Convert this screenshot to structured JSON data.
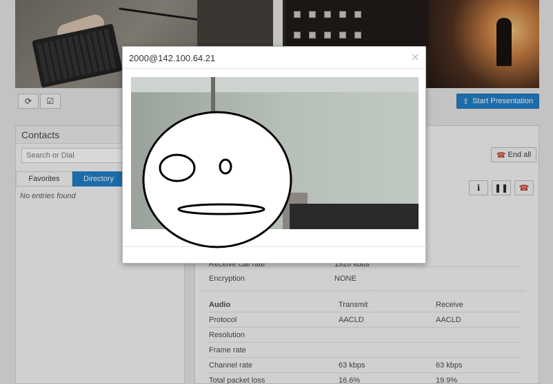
{
  "modal": {
    "title": "2000@142.100.64.21",
    "close_glyph": "×"
  },
  "toolbar": {
    "refresh_icon": "refresh-icon",
    "check_icon": "checkbox-icon",
    "present_label": "Start Presentation"
  },
  "contacts": {
    "title": "Contacts",
    "search_placeholder": "Search or Dial",
    "tabs": [
      "Favorites",
      "Directory"
    ],
    "empty_message": "No entries found"
  },
  "call": {
    "end_all_label": "End all",
    "controls": [
      "info-icon",
      "pause-icon",
      "hangup-icon"
    ],
    "partial_row": {
      "label": "Receive call rate",
      "value": "1920 kbps"
    },
    "encryption": {
      "label": "Encryption",
      "value": "NONE"
    },
    "audio": {
      "headers": [
        "Audio",
        "Transmit",
        "Receive"
      ],
      "rows": [
        [
          "Protocol",
          "AACLD",
          "AACLD"
        ],
        [
          "Resolution",
          "",
          ""
        ],
        [
          "Frame rate",
          "",
          ""
        ],
        [
          "Channel rate",
          "63 kbps",
          "63 kbps"
        ],
        [
          "Total packet loss",
          "16.6%",
          "19.9%"
        ]
      ]
    }
  },
  "colors": {
    "primary": "#1a7cc7",
    "danger": "#c0392b"
  }
}
